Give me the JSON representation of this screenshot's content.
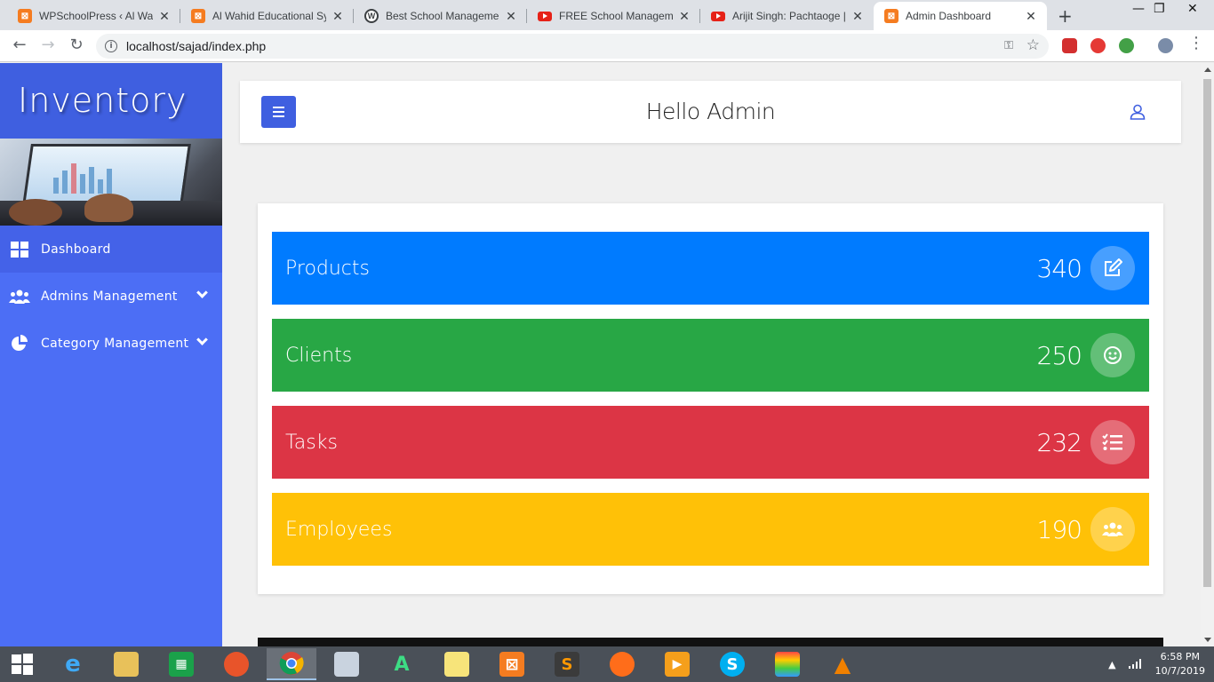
{
  "browser": {
    "tabs": [
      {
        "title": "WPSchoolPress ‹ Al Wah",
        "icon": "xampp-icon"
      },
      {
        "title": "Al Wahid Educational Sy",
        "icon": "xampp-icon"
      },
      {
        "title": "Best School Managemen",
        "icon": "wordpress-icon"
      },
      {
        "title": "FREE School Managemen",
        "icon": "youtube-icon"
      },
      {
        "title": "Arijit Singh: Pachtaoge |",
        "icon": "youtube-icon"
      },
      {
        "title": "Admin Dashboard",
        "icon": "xampp-icon"
      }
    ],
    "close_glyph": "✕",
    "new_tab_glyph": "+",
    "url": "localhost/sajad/index.php"
  },
  "sidebar": {
    "brand": "Inventory",
    "items": [
      {
        "label": "Dashboard",
        "icon": "grid-icon"
      },
      {
        "label": "Admins Management",
        "icon": "users-icon"
      },
      {
        "label": "Category Management",
        "icon": "pie-chart-icon"
      }
    ]
  },
  "header": {
    "greeting": "Hello Admin"
  },
  "stats": [
    {
      "label": "Products",
      "value": "340",
      "color": "#007bff",
      "icon": "edit-icon"
    },
    {
      "label": "Clients",
      "value": "250",
      "color": "#28a745",
      "icon": "smile-icon"
    },
    {
      "label": "Tasks",
      "value": "232",
      "color": "#dc3545",
      "icon": "tasks-icon"
    },
    {
      "label": "Employees",
      "value": "190",
      "color": "#ffc107",
      "icon": "users-icon"
    }
  ],
  "taskbar": {
    "time": "6:58 PM",
    "date": "10/7/2019"
  }
}
